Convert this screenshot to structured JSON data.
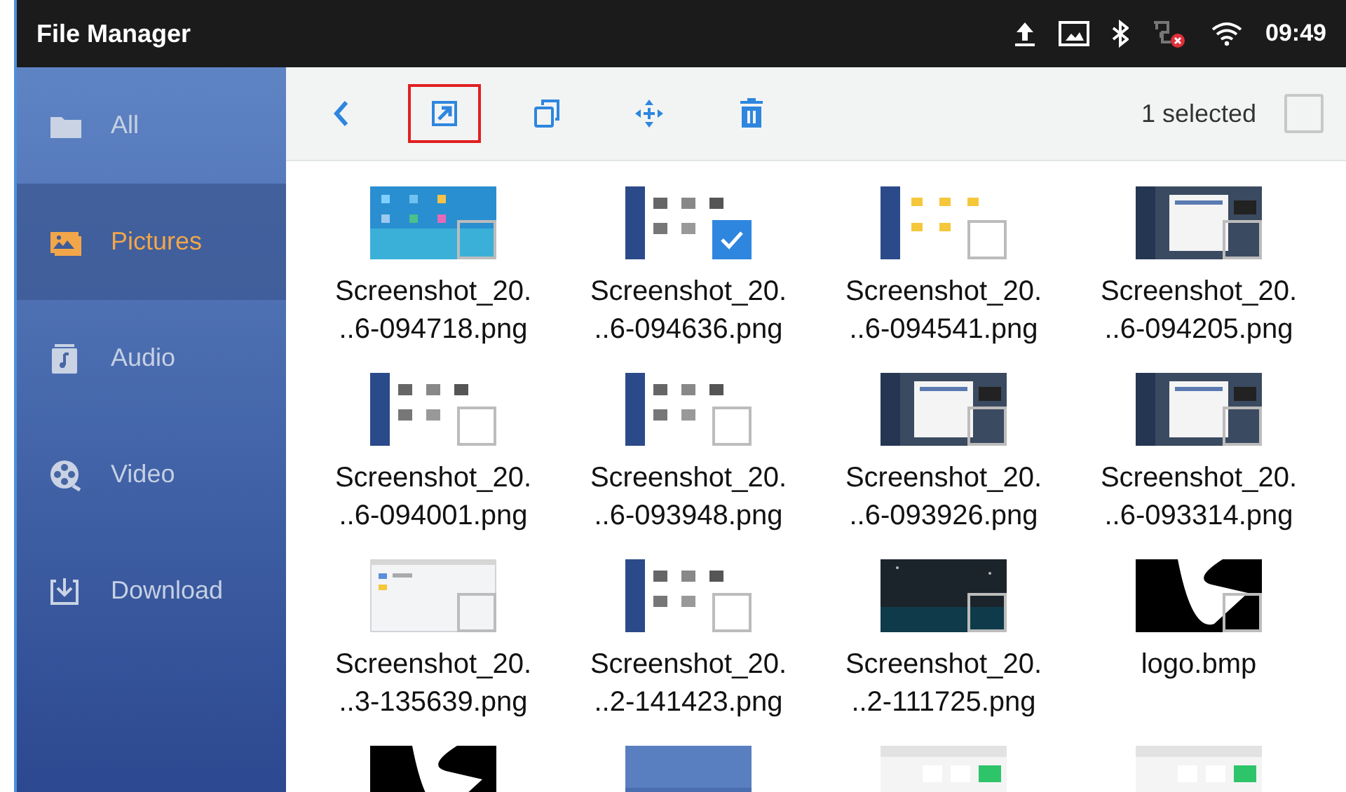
{
  "window": {
    "title": "File Manager"
  },
  "status_bar": {
    "time": "09:49"
  },
  "sidebar": {
    "items": [
      {
        "label": "All",
        "kind": "folder",
        "selected": false
      },
      {
        "label": "Pictures",
        "kind": "pictures",
        "selected": true
      },
      {
        "label": "Audio",
        "kind": "audio",
        "selected": false
      },
      {
        "label": "Video",
        "kind": "video",
        "selected": false
      },
      {
        "label": "Download",
        "kind": "download",
        "selected": false
      }
    ]
  },
  "toolbar": {
    "actions": [
      {
        "kind": "back",
        "highlighted": false
      },
      {
        "kind": "export",
        "highlighted": true
      },
      {
        "kind": "copy",
        "highlighted": false
      },
      {
        "kind": "move",
        "highlighted": false
      },
      {
        "kind": "delete",
        "highlighted": false
      }
    ],
    "selection_count": "1 selected",
    "select_all": {
      "checked": false
    }
  },
  "files": [
    {
      "kind": "file",
      "name": [
        "Screenshot_20.",
        "..6-094718.png"
      ],
      "selected": false
    },
    {
      "kind": "file",
      "name": [
        "Screenshot_20.",
        "..6-094636.png"
      ],
      "selected": true
    },
    {
      "kind": "file",
      "name": [
        "Screenshot_20.",
        "..6-094541.png"
      ],
      "selected": false
    },
    {
      "kind": "file",
      "name": [
        "Screenshot_20.",
        "..6-094205.png"
      ],
      "selected": false
    },
    {
      "kind": "file",
      "name": [
        "Screenshot_20.",
        "..6-094001.png"
      ],
      "selected": false
    },
    {
      "kind": "file",
      "name": [
        "Screenshot_20.",
        "..6-093948.png"
      ],
      "selected": false
    },
    {
      "kind": "file",
      "name": [
        "Screenshot_20.",
        "..6-093926.png"
      ],
      "selected": false
    },
    {
      "kind": "file",
      "name": [
        "Screenshot_20.",
        "..6-093314.png"
      ],
      "selected": false
    },
    {
      "kind": "file",
      "name": [
        "Screenshot_20.",
        "..3-135639.png"
      ],
      "selected": false
    },
    {
      "kind": "file",
      "name": [
        "Screenshot_20.",
        "..2-141423.png"
      ],
      "selected": false
    },
    {
      "kind": "file",
      "name": [
        "Screenshot_20.",
        "..2-111725.png"
      ],
      "selected": false
    },
    {
      "kind": "file",
      "name": [
        "logo.bmp"
      ],
      "selected": false
    },
    {
      "kind": "picture"
    },
    {
      "kind": "picture"
    },
    {
      "kind": "picture"
    },
    {
      "kind": "picture"
    }
  ]
}
